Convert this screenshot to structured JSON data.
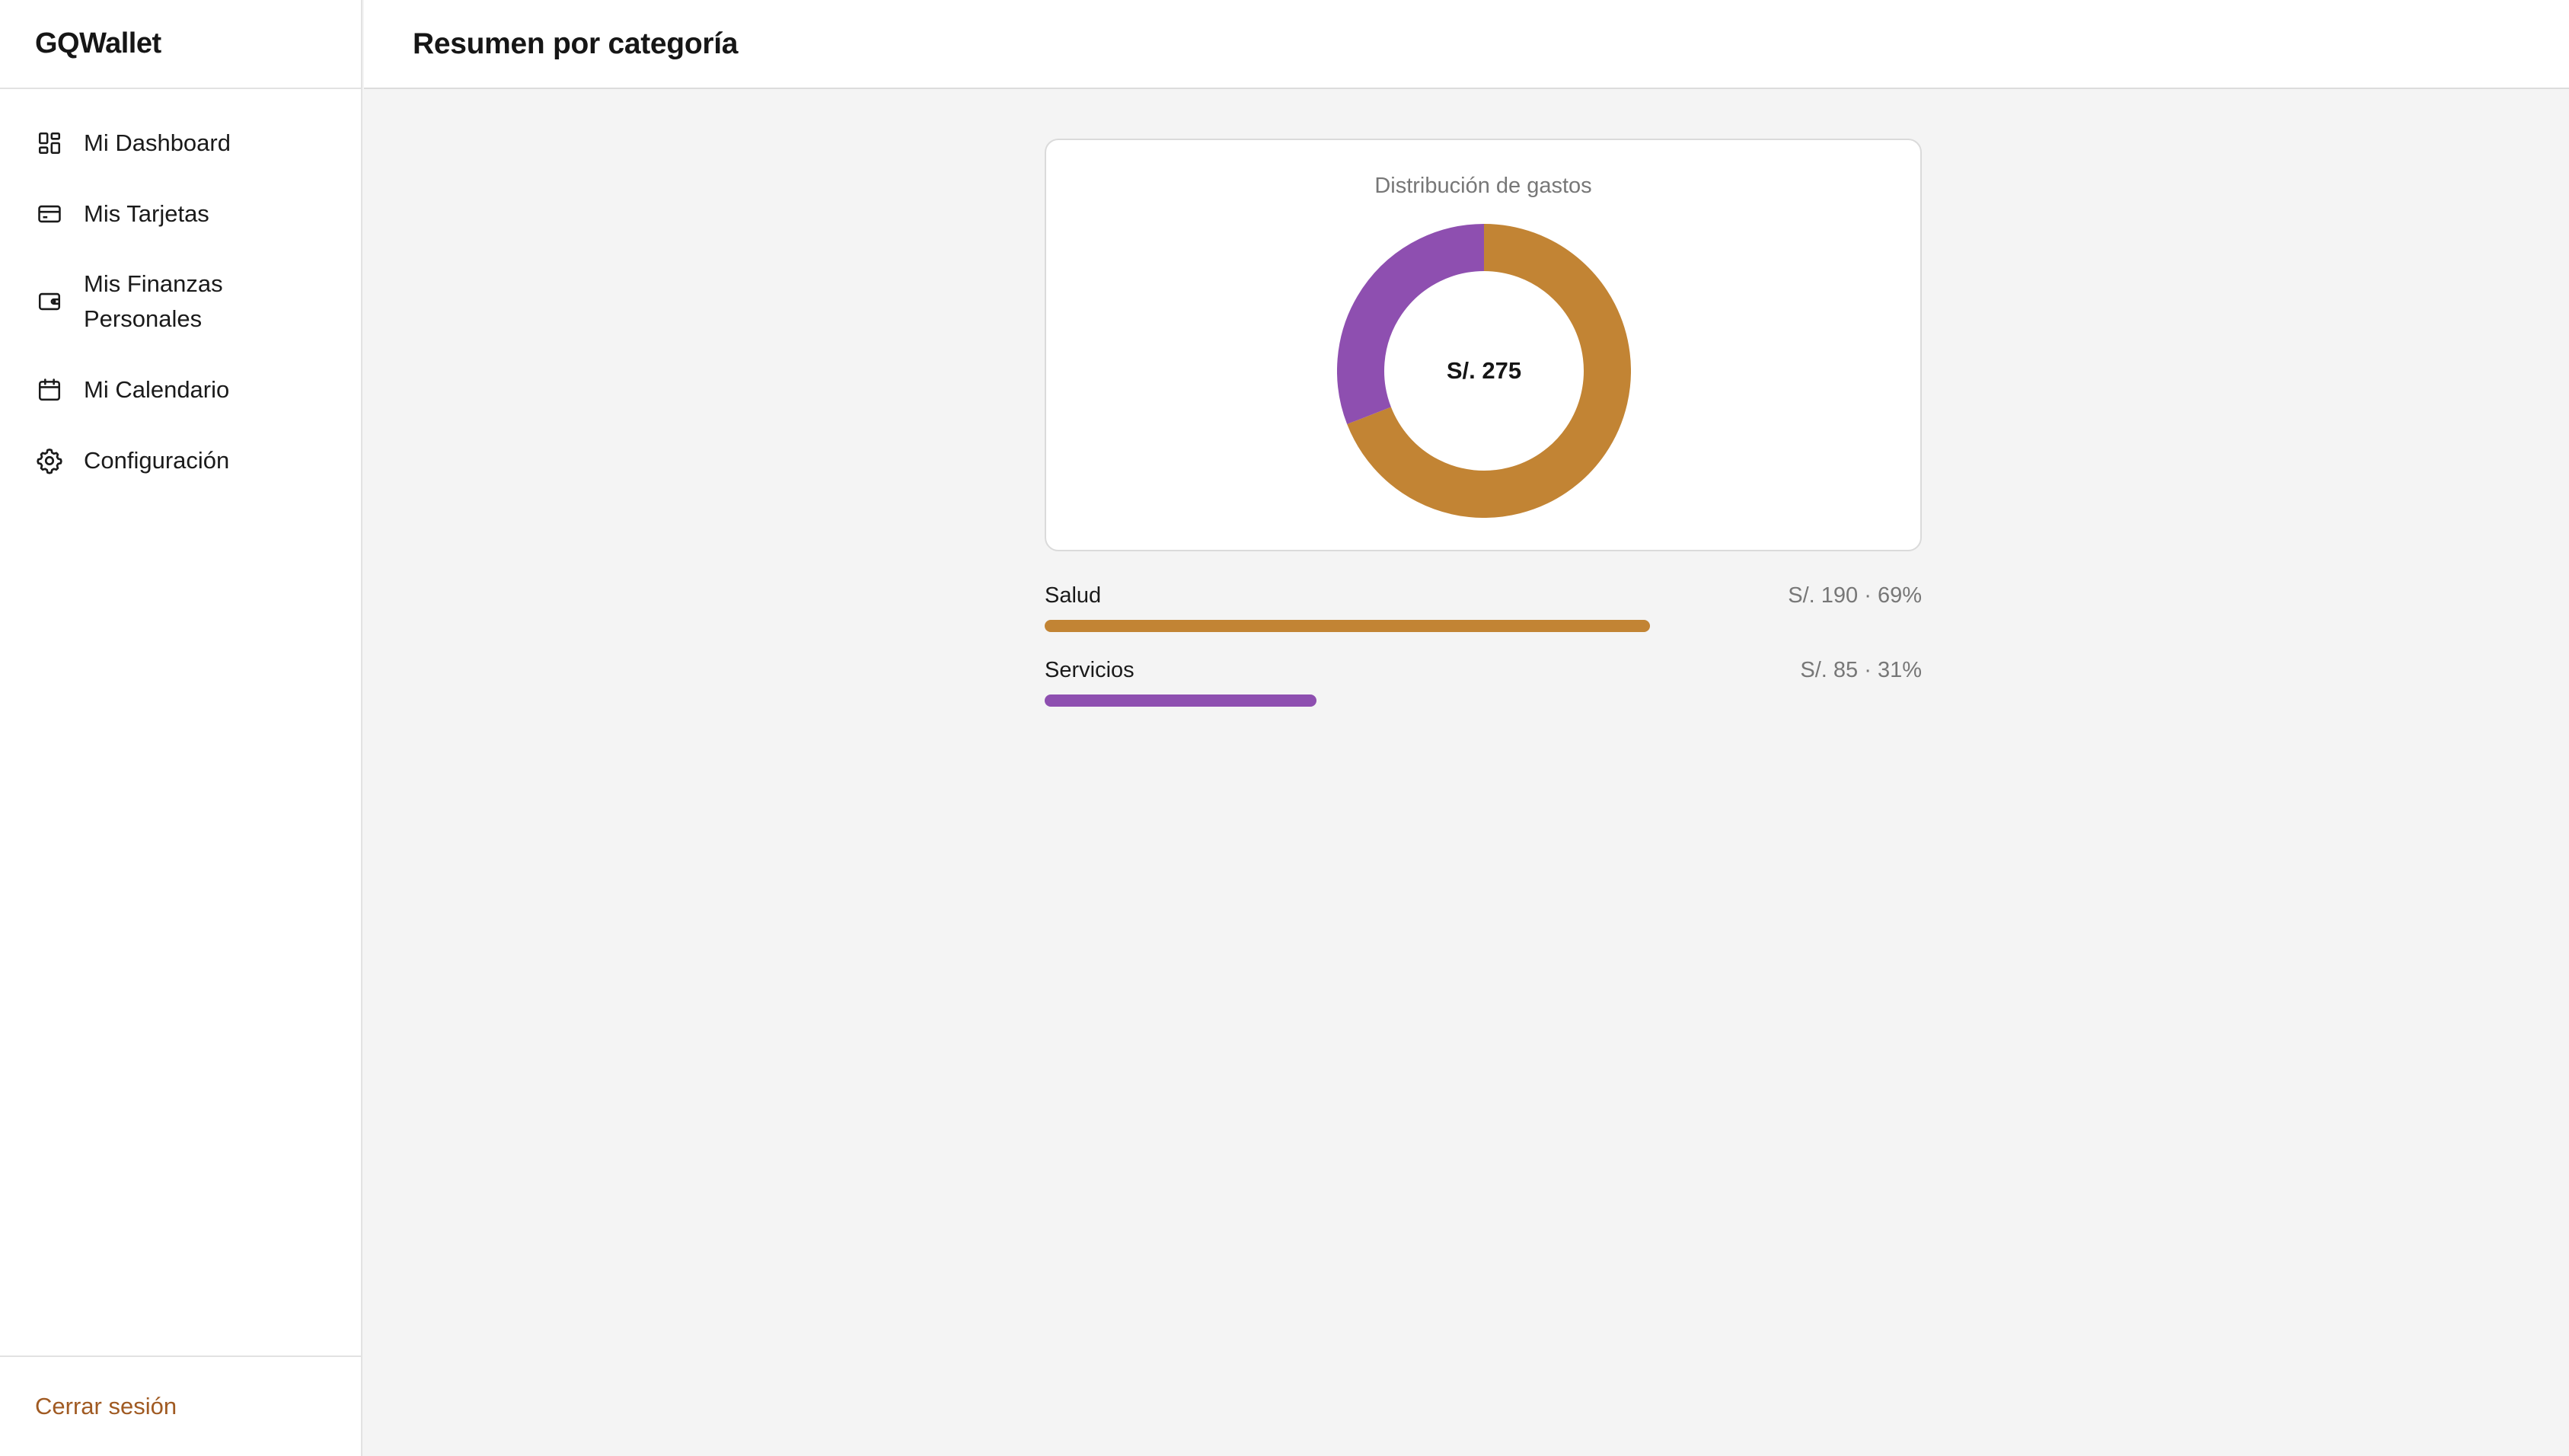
{
  "app": {
    "brand": "GQWallet"
  },
  "sidebar": {
    "items": [
      {
        "label": "Mi Dashboard",
        "icon": "dashboard-grid-icon"
      },
      {
        "label": "Mis Tarjetas",
        "icon": "credit-card-icon"
      },
      {
        "label": "Mis Finanzas Personales",
        "icon": "wallet-icon"
      },
      {
        "label": "Mi Calendario",
        "icon": "calendar-icon"
      },
      {
        "label": "Configuración",
        "icon": "gear-icon"
      }
    ],
    "logout_label": "Cerrar sesión"
  },
  "header": {
    "title": "Resumen por categoría"
  },
  "colors": {
    "salud": "#c28434",
    "servicios": "#8e4fb0",
    "logout": "#a05a22"
  },
  "summary": {
    "card_title": "Distribución de gastos",
    "total_label": "S/. 275",
    "categories": [
      {
        "name": "Salud",
        "value_label": "S/. 190 · 69%",
        "fraction": 0.69,
        "color": "#c28434"
      },
      {
        "name": "Servicios",
        "value_label": "S/. 85 · 31%",
        "fraction": 0.31,
        "color": "#8e4fb0"
      }
    ]
  },
  "chart_data": {
    "type": "pie",
    "title": "Distribución de gastos",
    "categories": [
      "Salud",
      "Servicios"
    ],
    "values": [
      190,
      85
    ],
    "center_label": "S/. 275"
  }
}
